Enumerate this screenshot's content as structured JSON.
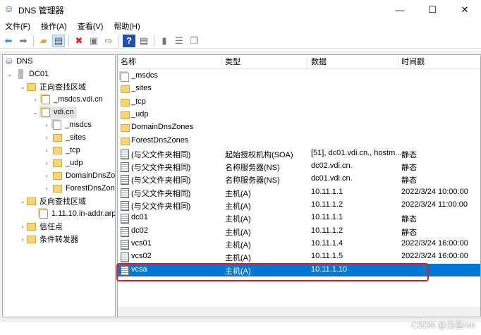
{
  "window": {
    "title": "DNS 管理器",
    "minimize": "—",
    "maximize": "☐",
    "close": "✕"
  },
  "menu": [
    "文件(F)",
    "操作(A)",
    "查看(V)",
    "帮助(H)"
  ],
  "tree": {
    "root": "DNS",
    "server": "DC01",
    "forward": "正向查找区域",
    "msdcs_zone": "_msdcs.vdi.cn",
    "vdi": "vdi.cn",
    "children": [
      "_msdcs",
      "_sites",
      "_tcp",
      "_udp",
      "DomainDnsZones",
      "ForestDnsZones"
    ],
    "reverse": "反向查找区域",
    "reverse_zone": "1.11.10.in-addr.arpa",
    "trust": "信任点",
    "forwarders": "条件转发器"
  },
  "columns": [
    "名称",
    "类型",
    "数据",
    "时间戳"
  ],
  "folders": [
    "_msdcs",
    "_sites",
    "_tcp",
    "_udp",
    "DomainDnsZones",
    "ForestDnsZones"
  ],
  "records": [
    {
      "name": "(与父文件夹相同)",
      "type": "起始授权机构(SOA)",
      "data": "[51], dc01.vdi.cn., hostm...",
      "ts": "静态"
    },
    {
      "name": "(与父文件夹相同)",
      "type": "名称服务器(NS)",
      "data": "dc02.vdi.cn.",
      "ts": "静态"
    },
    {
      "name": "(与父文件夹相同)",
      "type": "名称服务器(NS)",
      "data": "dc01.vdi.cn.",
      "ts": "静态"
    },
    {
      "name": "(与父文件夹相同)",
      "type": "主机(A)",
      "data": "10.11.1.1",
      "ts": "2022/3/24 10:00:00"
    },
    {
      "name": "(与父文件夹相同)",
      "type": "主机(A)",
      "data": "10.11.1.2",
      "ts": "2022/3/24 11:00:00"
    },
    {
      "name": "dc01",
      "type": "主机(A)",
      "data": "10.11.1.1",
      "ts": "静态"
    },
    {
      "name": "dc02",
      "type": "主机(A)",
      "data": "10.11.1.2",
      "ts": "静态"
    },
    {
      "name": "vcs01",
      "type": "主机(A)",
      "data": "10.11.1.4",
      "ts": "2022/3/24 16:00:00"
    },
    {
      "name": "vcs02",
      "type": "主机(A)",
      "data": "10.11.1.5",
      "ts": "2022/3/24 16:00:00"
    },
    {
      "name": "vcsa",
      "type": "主机(A)",
      "data": "10.11.1.10",
      "ts": ""
    }
  ],
  "watermark": "CSDN @白昼ron"
}
